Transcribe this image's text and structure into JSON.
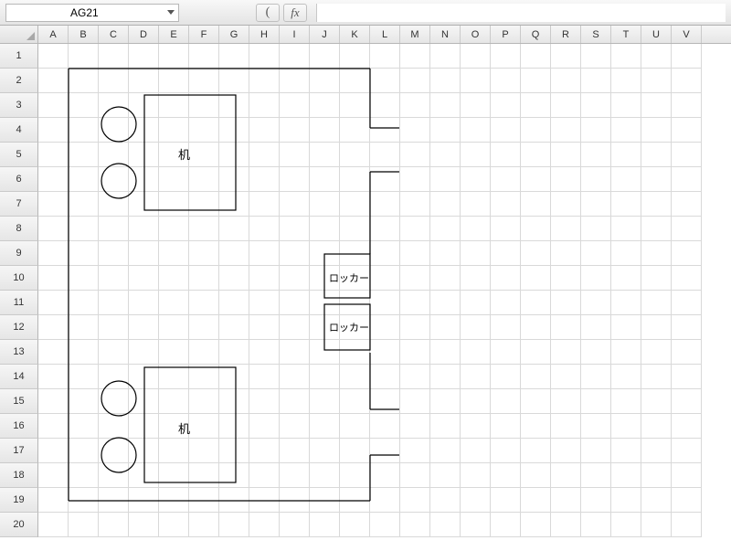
{
  "formula_bar": {
    "name_box_value": "AG21",
    "fx_label": "fx",
    "paren_label": "(",
    "formula_value": ""
  },
  "columns": [
    "A",
    "B",
    "C",
    "D",
    "E",
    "F",
    "G",
    "H",
    "I",
    "J",
    "K",
    "L",
    "M",
    "N",
    "O",
    "P",
    "Q",
    "R",
    "S",
    "T",
    "U",
    "V"
  ],
  "row_count": 20,
  "shapes": {
    "desk1_label": "机",
    "desk2_label": "机",
    "locker1_label": "ロッカー",
    "locker2_label": "ロッカー"
  }
}
